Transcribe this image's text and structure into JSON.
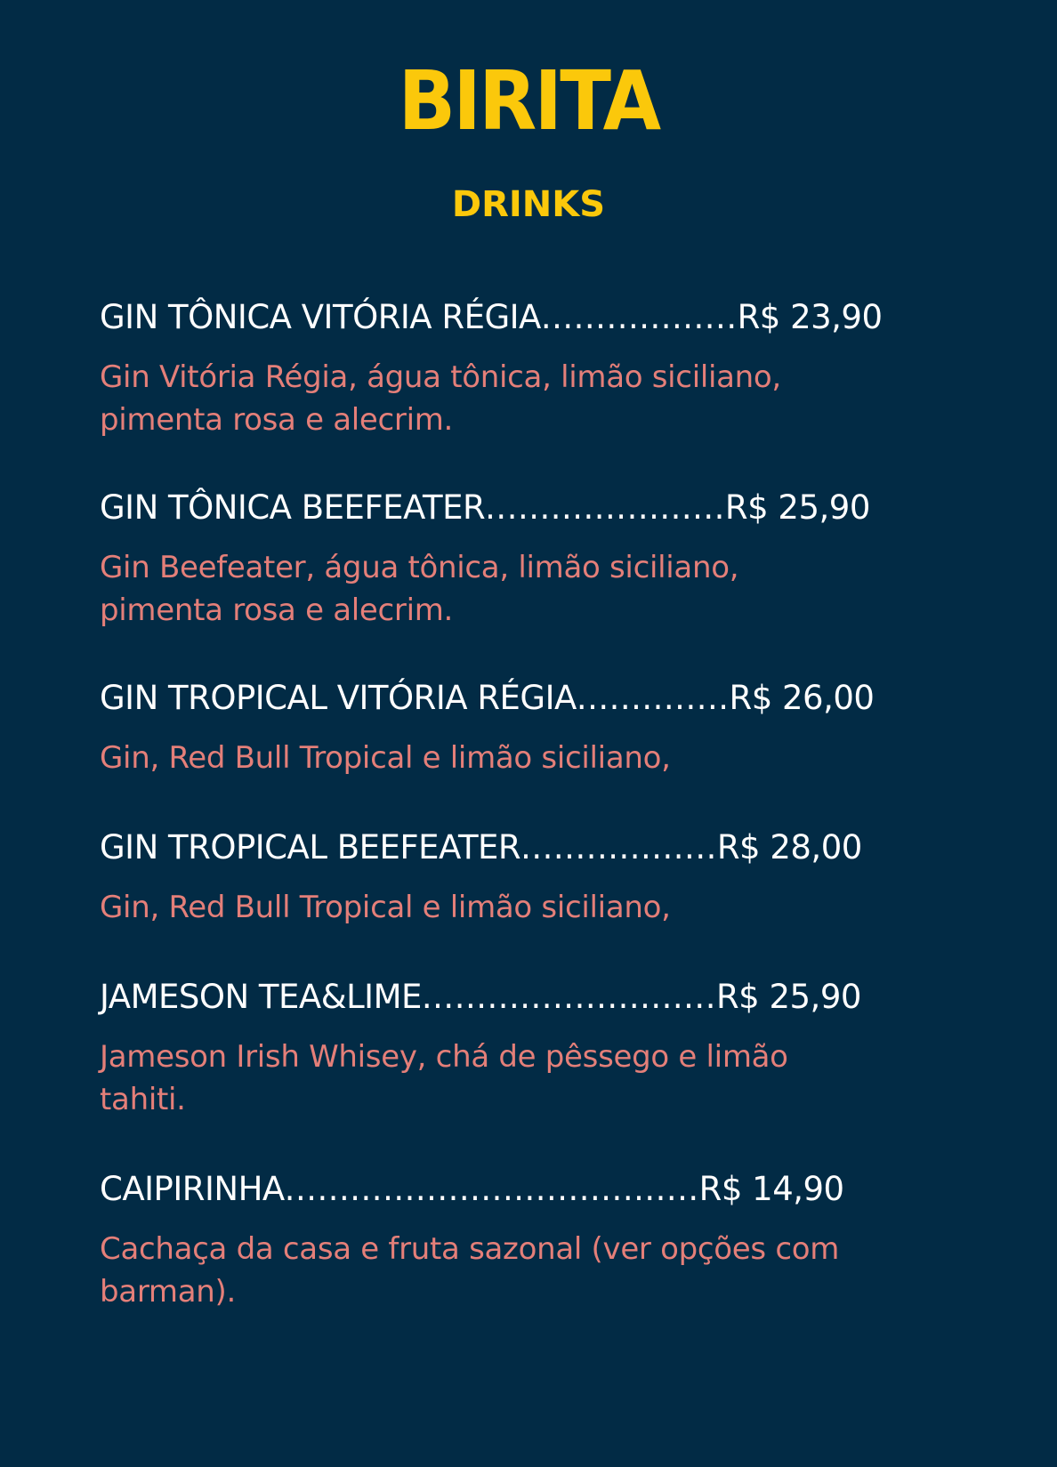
{
  "header": {
    "logo_text": "BIRITA",
    "section_title": "DRINKS"
  },
  "colors": {
    "background": "#022b45",
    "accent": "#fbc80b",
    "item_text": "#ffffff",
    "description_text": "#e47f79"
  },
  "menu": {
    "items": [
      {
        "name": "GIN TÔNICA VITÓRIA RÉGIA",
        "dots": "..................",
        "price": "R$ 23,90",
        "description": "Gin Vitória Régia, água tônica, limão siciliano, pimenta rosa e alecrim."
      },
      {
        "name": "GIN TÔNICA BEEFEATER",
        "dots": "......................",
        "price": "R$ 25,90",
        "description": "Gin Beefeater, água tônica, limão siciliano, pimenta rosa e alecrim."
      },
      {
        "name": "GIN TROPICAL VITÓRIA RÉGIA",
        "dots": "..............",
        "price": "R$ 26,00",
        "description": "Gin, Red Bull Tropical e limão siciliano,"
      },
      {
        "name": "GIN TROPICAL BEEFEATER",
        "dots": "..................",
        "price": "R$ 28,00",
        "description": "Gin, Red Bull Tropical e limão siciliano,"
      },
      {
        "name": "JAMESON TEA&LIME",
        "dots": "...........................",
        "price": "R$ 25,90",
        "description": "Jameson Irish Whisey, chá de pêssego e limão tahiti."
      },
      {
        "name": "CAIPIRINHA",
        "dots": "......................................",
        "price": "R$ 14,90",
        "description": "Cachaça da casa e fruta sazonal (ver opções com barman)."
      }
    ]
  }
}
